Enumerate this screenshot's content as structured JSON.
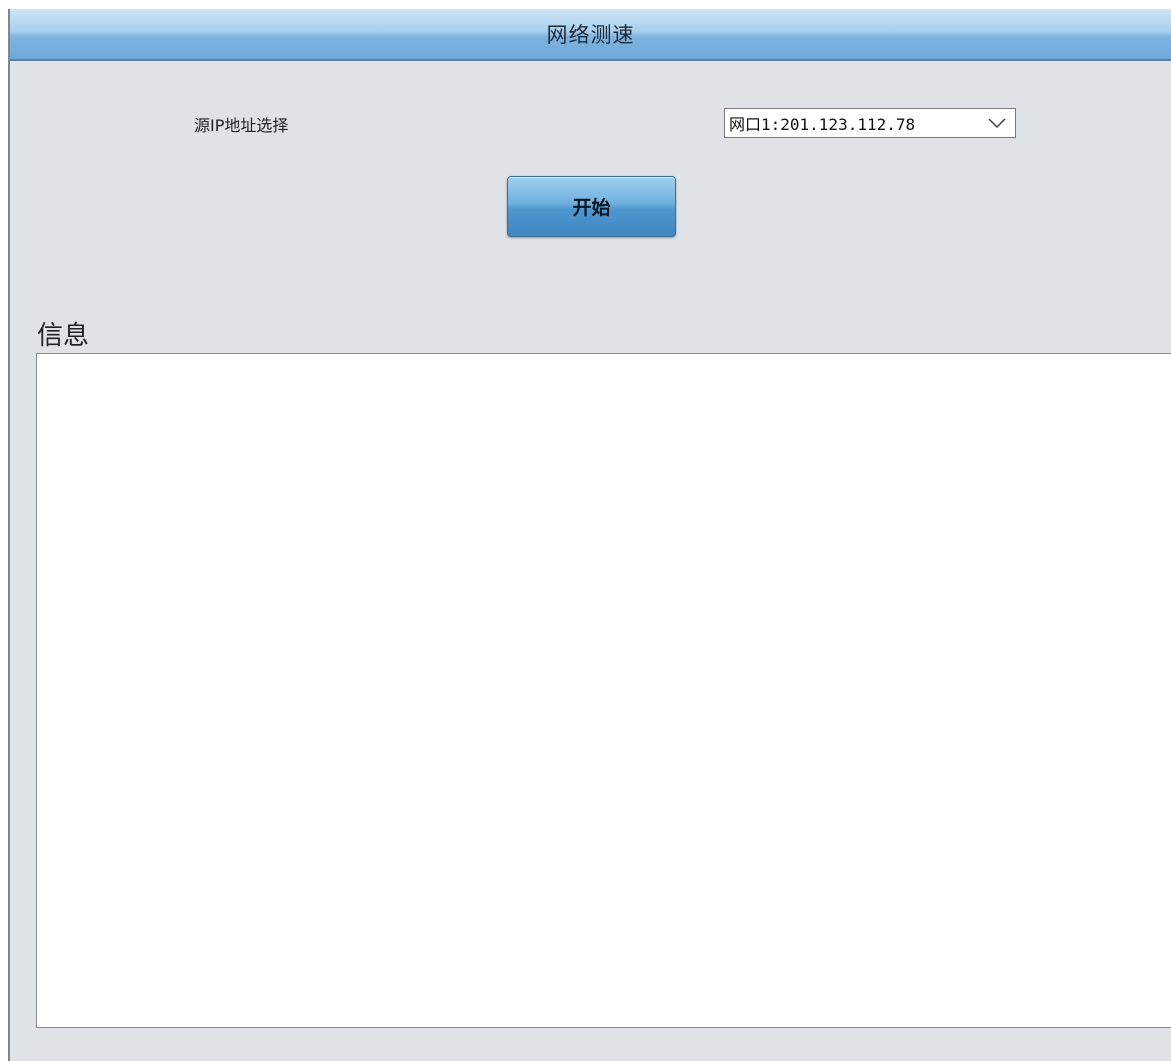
{
  "panel": {
    "title": "网络测速"
  },
  "form": {
    "source_ip_label": "源IP地址选择",
    "source_ip_selected": "网口1:201.123.112.78",
    "start_label": "开始"
  },
  "info": {
    "label": "信息",
    "content": ""
  },
  "icons": {
    "dropdown": "chevron-down-icon"
  },
  "colors": {
    "panel_bg": "#dfe2e7",
    "title_bar": "#7fb4e2",
    "button": "#4e97cf"
  }
}
